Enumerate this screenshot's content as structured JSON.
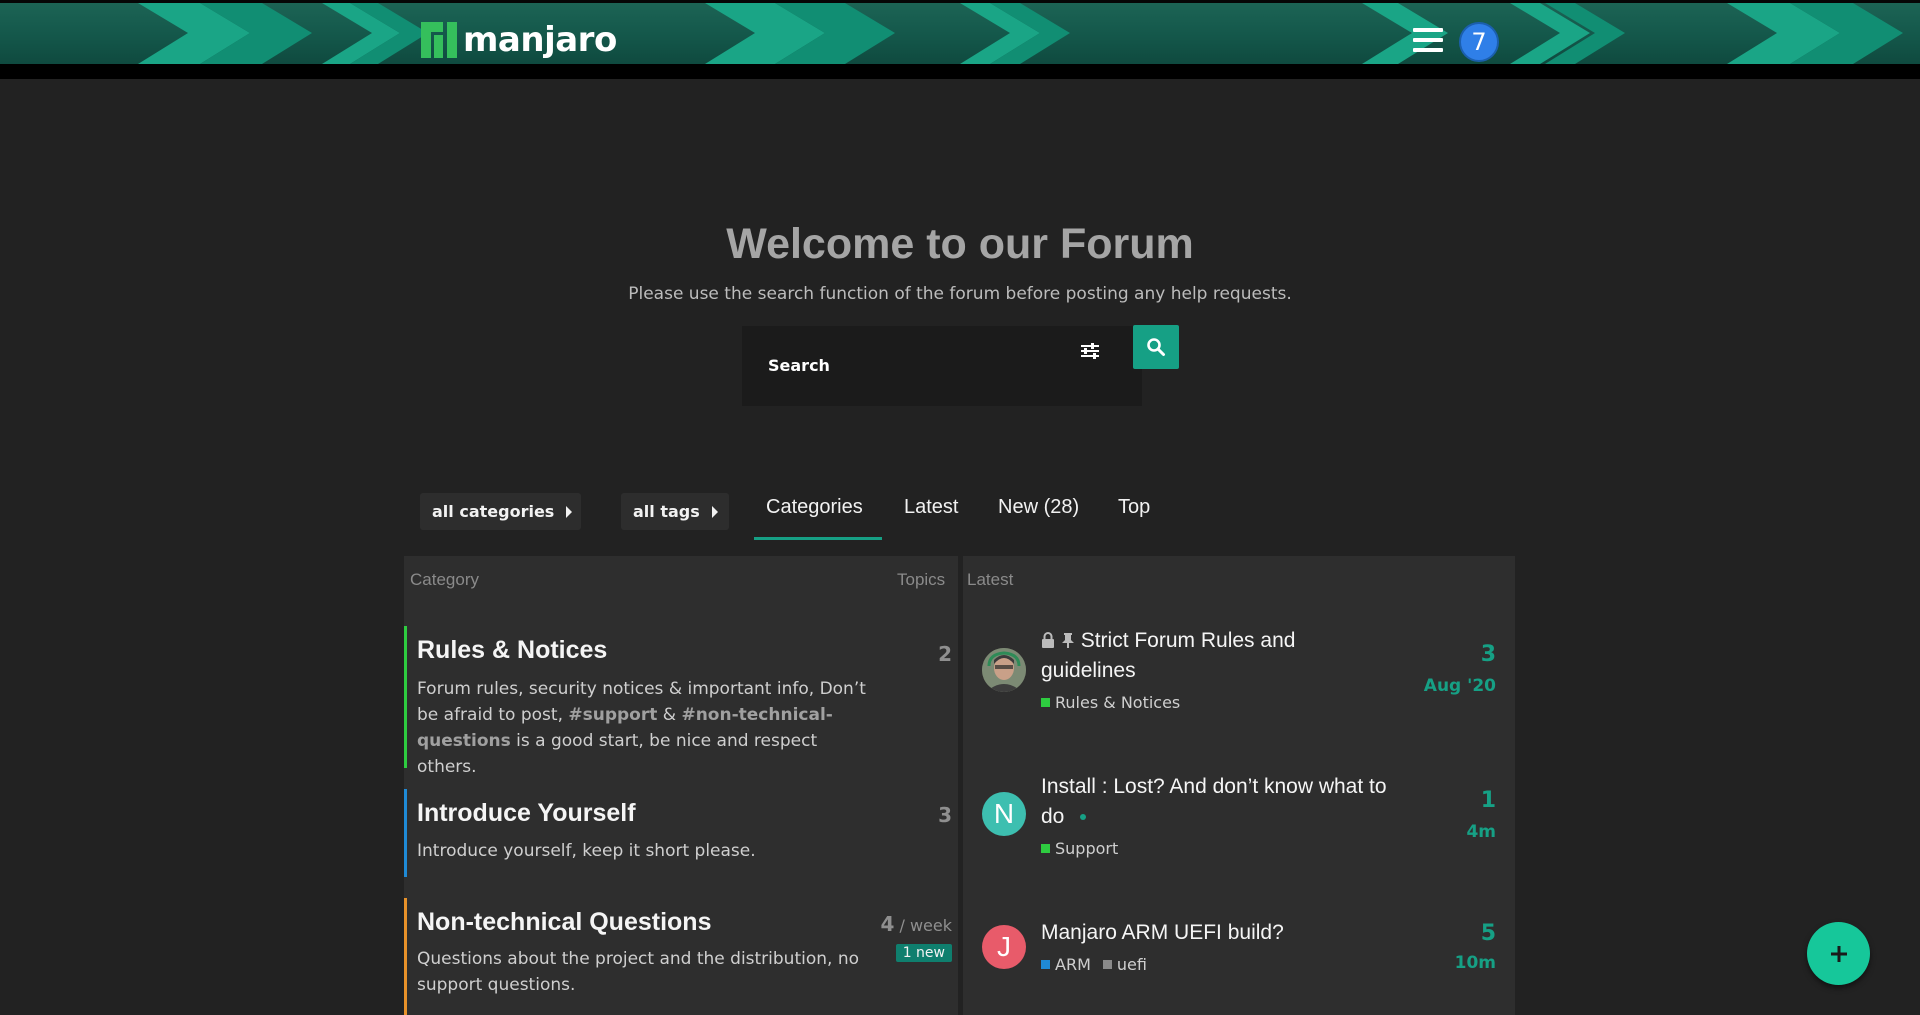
{
  "header": {
    "brand": "manjaro",
    "notification_count": "7"
  },
  "hero": {
    "title": "Welcome to our Forum",
    "subtitle": "Please use the search function of the forum before posting any help requests.",
    "search_placeholder": "Search"
  },
  "nav": {
    "categories_dropdown": "all categories",
    "tags_dropdown": "all tags",
    "tabs": [
      {
        "label": "Categories",
        "active": true
      },
      {
        "label": "Latest",
        "active": false
      },
      {
        "label": "New (28)",
        "active": false
      },
      {
        "label": "Top",
        "active": false
      }
    ]
  },
  "categories_table": {
    "col_category": "Category",
    "col_topics": "Topics",
    "rows": [
      {
        "name": "Rules & Notices",
        "color": "#2ecc40",
        "desc_part1": "Forum rules, security notices & important info, Don’t be afraid to post, ",
        "desc_link1": "#support",
        "desc_part2": " & ",
        "desc_link2": "#non-technical-questions",
        "desc_part3": " is a good start, be nice and respect others.",
        "topics": "2"
      },
      {
        "name": "Introduce Yourself",
        "color": "#1f8ad6",
        "desc": "Introduce yourself, keep it short please.",
        "topics": "3"
      },
      {
        "name": "Non-technical Questions",
        "color": "#e8922a",
        "desc": "Questions about the project and the distribution, no support questions.",
        "topics": "4",
        "topics_unit": " / week",
        "new_badge": "1 new"
      }
    ]
  },
  "latest_table": {
    "col_latest": "Latest",
    "topics": [
      {
        "title": "Strict Forum Rules and guidelines",
        "locked": true,
        "pinned": true,
        "category": "Rules & Notices",
        "category_color": "#2ecc40",
        "replies": "3",
        "time": "Aug '20",
        "avatar_type": "photo"
      },
      {
        "title": "Install : Lost? And don’t know what to do",
        "category": "Support",
        "category_color": "#2ecc40",
        "replies": "1",
        "time": "4m",
        "avatar_letter": "N",
        "avatar_color": "#3dbfb0"
      },
      {
        "title": "Manjaro ARM UEFI build?",
        "category": "ARM",
        "category_color": "#1f8ad6",
        "tag": "uefi",
        "replies": "5",
        "time": "10m",
        "avatar_letter": "J",
        "avatar_color": "#e85b6a"
      }
    ]
  },
  "colors": {
    "accent": "#16a085",
    "fab": "#16c79a",
    "badge_blue": "#2f7fe8"
  }
}
